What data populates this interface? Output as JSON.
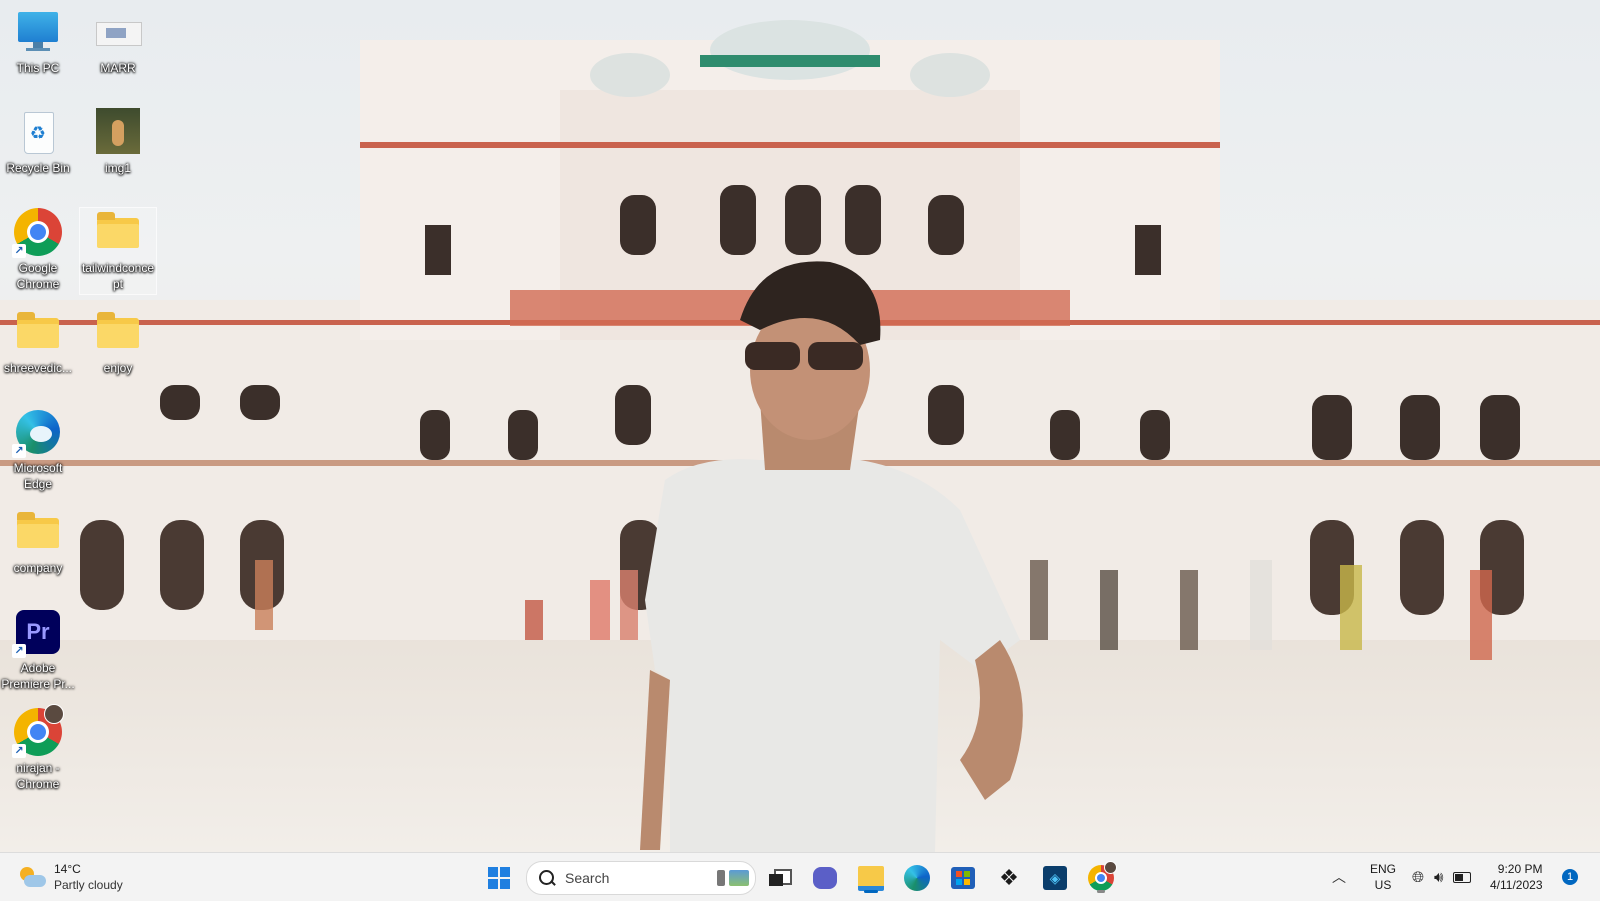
{
  "desktop": {
    "icons": [
      {
        "label": "This PC"
      },
      {
        "label": "MARR"
      },
      {
        "label": "Recycle Bin"
      },
      {
        "label": "img1"
      },
      {
        "label": "Google Chrome"
      },
      {
        "label": "tailwindconcept"
      },
      {
        "label": "shreevedic..."
      },
      {
        "label": "enjoy"
      },
      {
        "label": "Microsoft Edge"
      },
      {
        "label": "company"
      },
      {
        "label": "Adobe Premiere Pr..."
      },
      {
        "label": "nirajan - Chrome"
      }
    ]
  },
  "taskbar": {
    "weather": {
      "temp": "14°C",
      "condition": "Partly cloudy"
    },
    "search": {
      "placeholder": "Search"
    },
    "pinned": [
      "start-icon",
      "task-view-icon",
      "chat-icon",
      "file-explorer-icon",
      "edge-icon",
      "store-icon",
      "dropbox-icon",
      "app-icon",
      "chrome-icon"
    ],
    "tray": {
      "lang_line1": "ENG",
      "lang_line2": "US",
      "time": "9:20 PM",
      "date": "4/11/2023",
      "notifications": "1"
    }
  },
  "colors": {
    "accent": "#0067c0",
    "folder": "#f7c948",
    "taskbar_bg": "#f3f3f3"
  }
}
